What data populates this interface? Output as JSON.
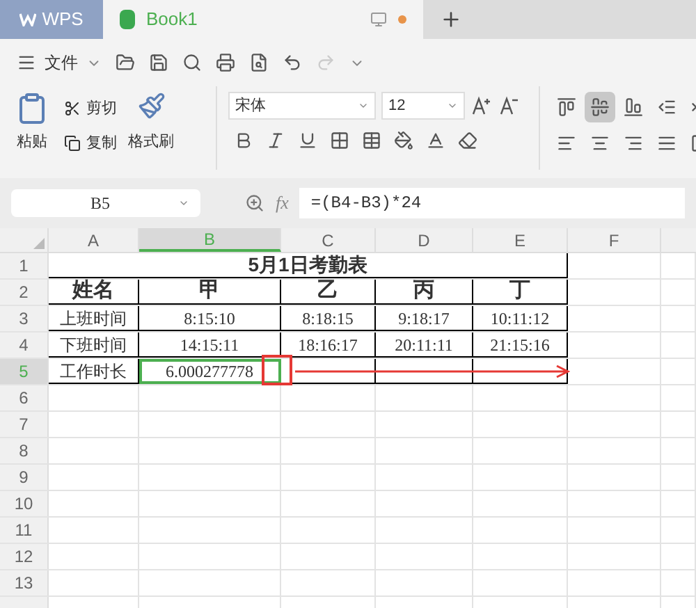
{
  "app_tab": {
    "label": "WPS"
  },
  "doc_tabs": [
    {
      "label": "Book1",
      "selected": true,
      "unsaved": true
    }
  ],
  "menu": {
    "label": "文件"
  },
  "quick_access": [
    {
      "kind": "open",
      "disabled": false
    },
    {
      "kind": "save",
      "disabled": false
    },
    {
      "kind": "find",
      "disabled": false
    },
    {
      "kind": "print",
      "disabled": false
    },
    {
      "kind": "preview",
      "disabled": false
    },
    {
      "kind": "undo",
      "disabled": false
    },
    {
      "kind": "redo",
      "disabled": true
    }
  ],
  "clipboard": {
    "paste": "粘贴",
    "cut": "剪切",
    "copy": "复制",
    "format_painter": "格式刷"
  },
  "font": {
    "name": "宋体",
    "size": "12"
  },
  "format_buttons": [
    {
      "kind": "bold"
    },
    {
      "kind": "italic"
    },
    {
      "kind": "underline"
    },
    {
      "kind": "borders"
    },
    {
      "kind": "cell-style"
    },
    {
      "kind": "fill"
    },
    {
      "kind": "font-color"
    },
    {
      "kind": "clear"
    }
  ],
  "align_top": [
    {
      "kind": "top",
      "selected": false
    },
    {
      "kind": "middle",
      "selected": true
    },
    {
      "kind": "bottom",
      "selected": false
    },
    {
      "kind": "outdent",
      "selected": false
    },
    {
      "kind": "indent",
      "selected": false
    }
  ],
  "align_bottom": [
    {
      "kind": "left",
      "selected": false
    },
    {
      "kind": "center",
      "selected": false
    },
    {
      "kind": "right",
      "selected": false
    },
    {
      "kind": "justify",
      "selected": false
    },
    {
      "kind": "distribute",
      "selected": false
    }
  ],
  "name_box": {
    "value": "B5"
  },
  "formula": {
    "function_label": "fx",
    "value": "=(B4-B3)*24"
  },
  "columns": [
    {
      "label": "A",
      "selected": false
    },
    {
      "label": "B",
      "selected": true
    },
    {
      "label": "C",
      "selected": false
    },
    {
      "label": "D",
      "selected": false
    },
    {
      "label": "E",
      "selected": false
    },
    {
      "label": "F",
      "selected": false
    }
  ],
  "rows": [
    {
      "label": "1",
      "selected": false,
      "title": "5月1日考勤表"
    },
    {
      "label": "2",
      "selected": false,
      "cells": [
        "姓名",
        "甲",
        "乙",
        "丙",
        "丁"
      ]
    },
    {
      "label": "3",
      "selected": false,
      "cells": [
        "上班时间",
        "8:15:10",
        "8:18:15",
        "9:18:17",
        "10:11:12"
      ]
    },
    {
      "label": "4",
      "selected": false,
      "cells": [
        "下班时间",
        "14:15:11",
        "18:16:17",
        "20:11:11",
        "21:15:16"
      ]
    },
    {
      "label": "5",
      "selected": true,
      "cells": [
        "工作时长",
        "6.000277778",
        "",
        "",
        ""
      ]
    },
    {
      "label": "6",
      "selected": false
    },
    {
      "label": "7",
      "selected": false
    },
    {
      "label": "8",
      "selected": false
    },
    {
      "label": "9",
      "selected": false
    },
    {
      "label": "10",
      "selected": false
    },
    {
      "label": "11",
      "selected": false
    },
    {
      "label": "12",
      "selected": false
    },
    {
      "label": "13",
      "selected": false
    }
  ]
}
